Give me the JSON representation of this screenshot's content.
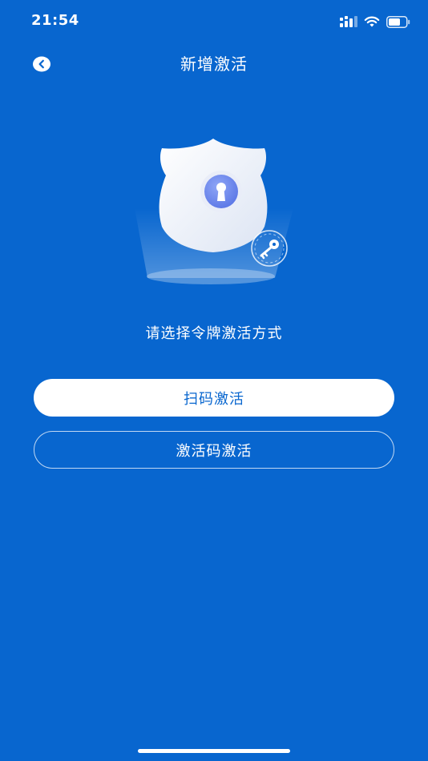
{
  "status_bar": {
    "time": "21:54",
    "icons": [
      "signal-icon",
      "wifi-icon",
      "battery-icon"
    ]
  },
  "nav": {
    "title": "新增激活",
    "back_icon": "chevron-left-icon"
  },
  "hero": {
    "icons": [
      "shield-icon",
      "keyhole-icon",
      "key-icon"
    ]
  },
  "instruction": "请选择令牌激活方式",
  "buttons": {
    "scan": "扫码激活",
    "code": "激活码激活"
  },
  "colors": {
    "background": "#0866CF",
    "primary_text": "#0866CF",
    "white": "#FFFFFF",
    "keyhole_circle": "#6F8CF0"
  }
}
